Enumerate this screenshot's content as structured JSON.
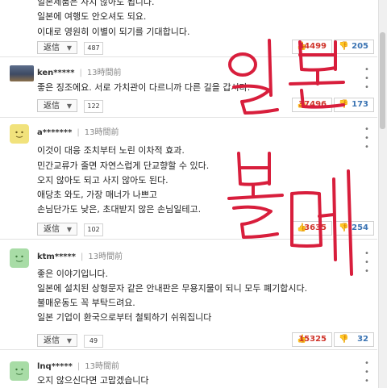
{
  "comments": [
    {
      "lines": [
        "일본제품은 사지 않아도 됩니다.",
        "일본에 여행도 안오셔도 되요.",
        "이대로 영원히 이별이 되기를 기대합니다."
      ],
      "reply_label": "返信",
      "reply_count": "487",
      "likes": "44499",
      "dislikes": "205"
    },
    {
      "user": "ken*****",
      "time": "13時間前",
      "avatar": "photo",
      "lines": [
        "좋은 징조에요. 서로 가치관이 다르니까 다른 길을 갑시다."
      ],
      "reply_label": "返信",
      "reply_count": "122",
      "likes": "37496",
      "dislikes": "173"
    },
    {
      "user": "a*******",
      "time": "13時間前",
      "avatar": "yellow",
      "lines": [
        "이것이 대응 조치부터 노린 이차적 효과.",
        "민간교류가 줄면 자연스럽게 단교향할 수 있다.",
        "오지 않아도 되고 사지 않아도 된다.",
        "애당초 와도, 가장 매너가 나쁘고",
        "손님단가도 낮은, 초대받지 않은 손님일테고."
      ],
      "reply_label": "返信",
      "reply_count": "102",
      "likes": "3635",
      "dislikes": "254"
    },
    {
      "user": "ktm*****",
      "time": "13時間前",
      "avatar": "green",
      "lines": [
        "좋은 이야기입니다.",
        "일본에 설치된 상형문자 같은 안내판은 무용지물이 되니 모두 폐기합시다.",
        "불매운동도 꼭 부탁드려요.",
        "일본 기업이 환국으로부터 철퇴하기 쉬워집니다"
      ],
      "reply_label": "返信",
      "reply_count": "49",
      "likes": "15325",
      "dislikes": "32"
    },
    {
      "user": "lnq*****",
      "time": "13時間前",
      "avatar": "green",
      "lines": [
        "오지 않으신다면 고맙겠습니다"
      ]
    }
  ],
  "overlay": {
    "word1": "일본",
    "word2": "불매",
    "color": "#d81e3c"
  },
  "icons": {
    "like": "thumbs-up-icon",
    "dislike": "thumbs-down-icon",
    "more": "more-dots-icon",
    "reply_arrow": "chevron-down-icon"
  }
}
